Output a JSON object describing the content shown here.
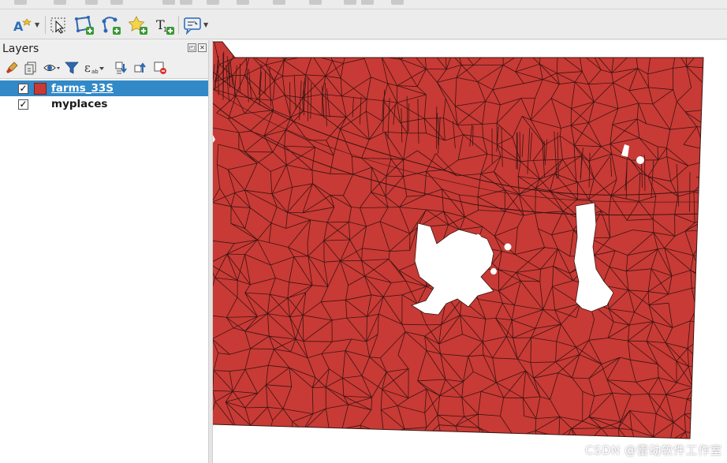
{
  "panel": {
    "title": "Layers",
    "float_glyph": "◰",
    "close_glyph": "✕"
  },
  "layers": [
    {
      "name": "farms_33S",
      "checked": "✓",
      "selected": true,
      "color": "#c83a35"
    },
    {
      "name": "myplaces",
      "checked": "✓",
      "selected": false
    }
  ],
  "colors": {
    "polygon_fill": "#c83a35",
    "polygon_stroke": "#3a1412",
    "selection": "#3189c7"
  },
  "toolbar_icons": [
    "label-tool-icon",
    "select-features-icon",
    "add-polygon-icon",
    "vertex-tool-icon",
    "add-point-icon",
    "text-annotation-icon",
    "identify-icon"
  ],
  "panel_tool_icons": [
    "style-brush-icon",
    "add-group-icon",
    "eye-visibility-icon",
    "filter-icon",
    "expression-icon",
    "expand-all-icon",
    "collapse-all-icon",
    "remove-layer-icon"
  ],
  "watermark": "CSDN @雷动软件工作室"
}
